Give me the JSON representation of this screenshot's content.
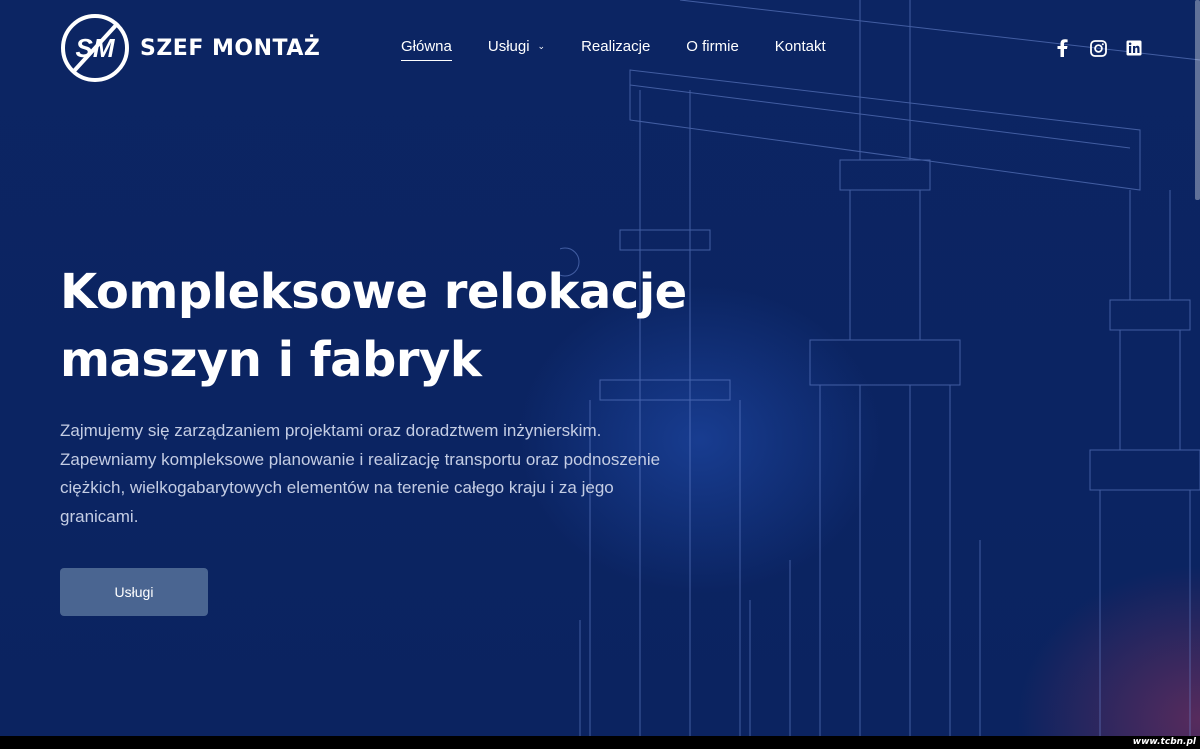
{
  "brand": {
    "logo_initials": "SM",
    "name": "SZEF MONTAŻ"
  },
  "nav": {
    "items": [
      {
        "label": "Główna",
        "active": true
      },
      {
        "label": "Usługi",
        "has_dropdown": true
      },
      {
        "label": "Realizacje"
      },
      {
        "label": "O firmie"
      },
      {
        "label": "Kontakt"
      }
    ]
  },
  "social": [
    "facebook-icon",
    "instagram-icon",
    "linkedin-icon"
  ],
  "hero": {
    "headline_line1": "Kompleksowe relokacje",
    "headline_line2": "maszyn i fabryk",
    "description": "Zajmujemy się zarządzaniem projektami oraz doradztwem inżynierskim. Zapewniamy kompleksowe planowanie i realizację transportu oraz podnoszenie ciężkich, wielkogabarytowych elementów na terenie całego kraju i za jego granicami.",
    "cta_label": "Usługi"
  },
  "watermark": "www.tcbn.pl",
  "colors": {
    "background": "#0b2463",
    "button": "#4a6591",
    "text": "#ffffff",
    "muted_text": "#c4cde4"
  }
}
